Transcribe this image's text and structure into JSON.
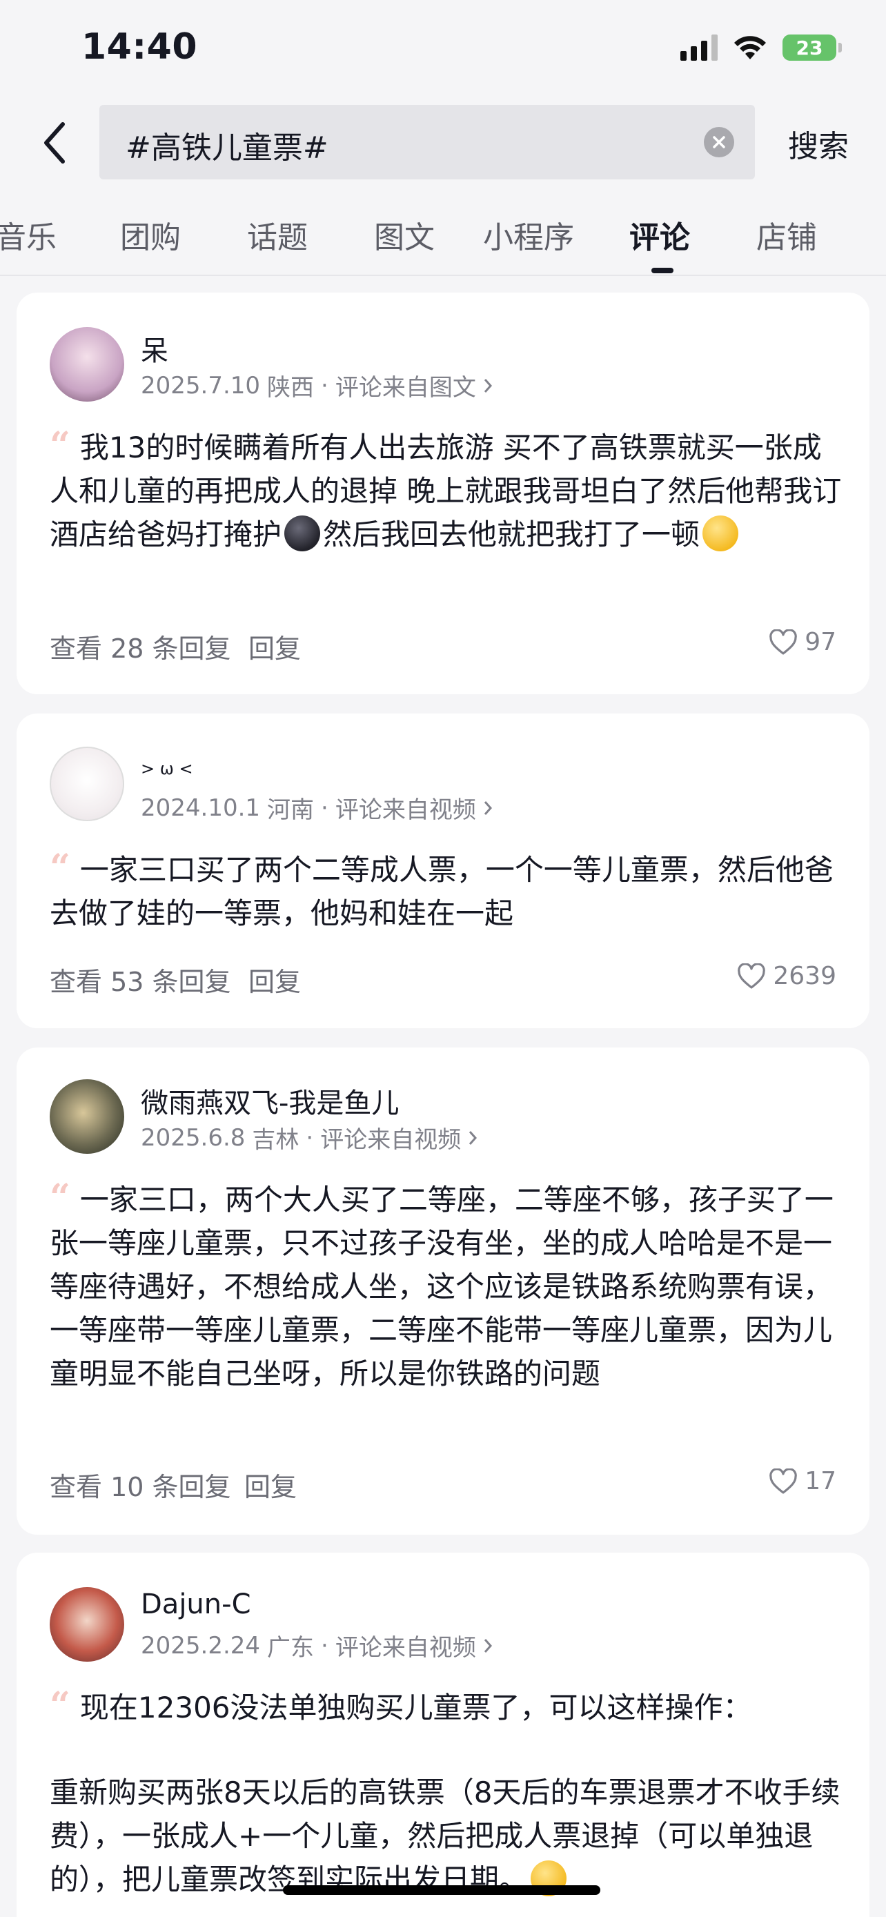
{
  "status_bar": {
    "time": "14:40",
    "battery": "23",
    "icons": [
      "signal-icon",
      "wifi-icon",
      "battery-charging-icon"
    ]
  },
  "search": {
    "query": "#高铁儿童票#",
    "button": "搜索"
  },
  "tabs": [
    {
      "label": "音乐"
    },
    {
      "label": "团购"
    },
    {
      "label": "话题"
    },
    {
      "label": "图文"
    },
    {
      "label": "小程序"
    },
    {
      "label": "评论",
      "active": true
    },
    {
      "label": "店铺"
    }
  ],
  "comments": [
    {
      "user": "呆",
      "date": "2025.7.10",
      "location": "陕西",
      "source": "评论来自图文",
      "text_a": "我13的时候瞒着所有人出去旅游 买不了高铁票就买一张成人和儿童的再把成人的退掉 晚上就跟我哥坦白了然后他帮我订酒店给爸妈打掩护",
      "text_b": "然后我回去他就把我打了一顿",
      "replies": "查看 28 条回复",
      "reply": "回复",
      "likes": "97"
    },
    {
      "user": "> ω <",
      "date": "2024.10.1",
      "location": "河南",
      "source": "评论来自视频",
      "text": "一家三口买了两个二等成人票，一个一等儿童票，然后他爸去做了娃的一等票，他妈和娃在一起",
      "replies": "查看 53 条回复",
      "reply": "回复",
      "likes": "2639"
    },
    {
      "user": "微雨燕双飞-我是鱼儿",
      "date": "2025.6.8",
      "location": "吉林",
      "source": "评论来自视频",
      "text": "一家三口，两个大人买了二等座，二等座不够，孩子买了一张一等座儿童票，只不过孩子没有坐，坐的成人哈哈是不是一等座待遇好，不想给成人坐，这个应该是铁路系统购票有误，一等座带一等座儿童票，二等座不能带一等座儿童票，因为儿童明显不能自己坐呀，所以是你铁路的问题",
      "replies": "查看 10 条回复",
      "reply": "回复",
      "likes": "17"
    },
    {
      "user": "Dajun-C",
      "date": "2025.2.24",
      "location": "广东",
      "source": "评论来自视频",
      "text_a": "现在12306没法单独购买儿童票了，可以这样操作：",
      "text_b": "重新购买两张8天以后的高铁票（8天后的车票退票才不收手续费），一张成人+一个儿童，然后把成人票退掉（可以单独退的），把儿童票改签到实际出发日期。"
    }
  ]
}
